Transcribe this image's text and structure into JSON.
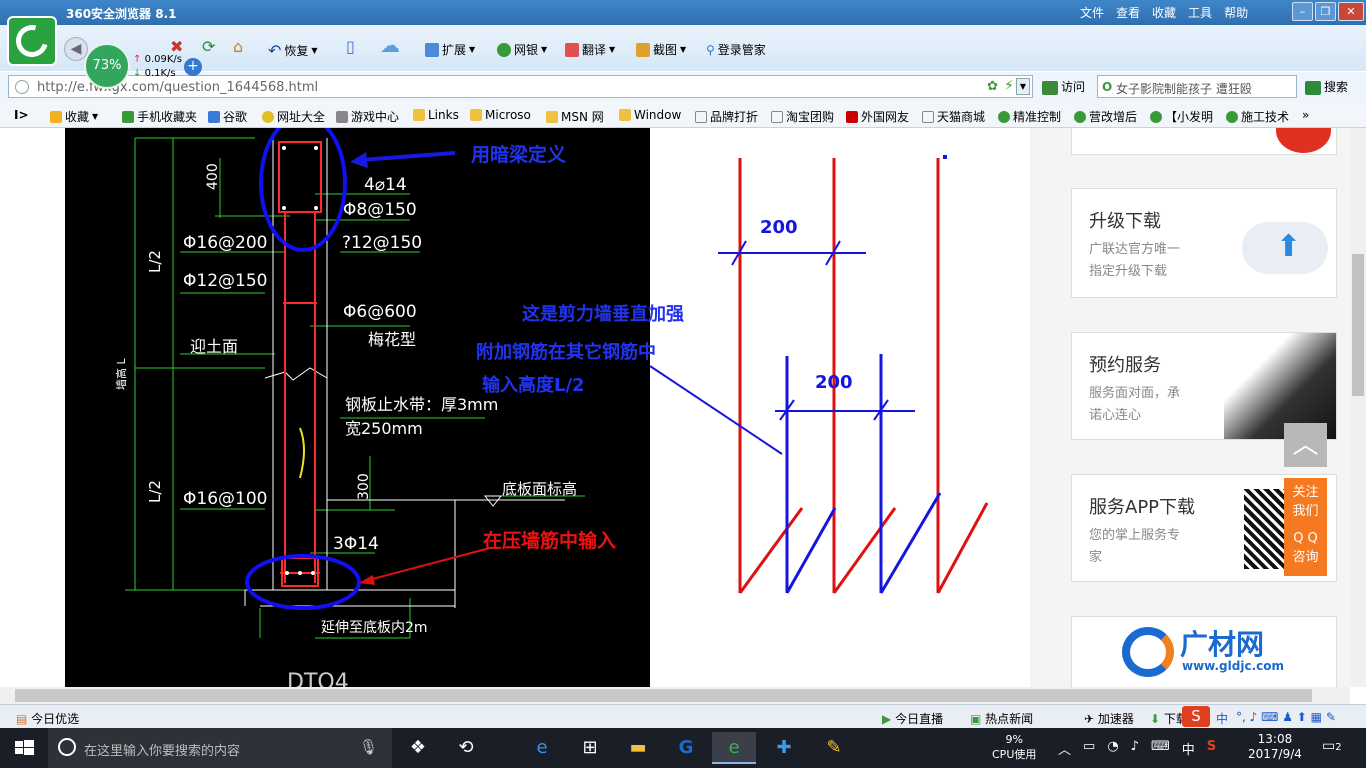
{
  "window": {
    "title": "360安全浏览器 8.1",
    "menu": [
      "文件",
      "查看",
      "收藏",
      "工具",
      "帮助"
    ]
  },
  "speed": {
    "percent": "73%",
    "up": "0.09K/s",
    "down": "0.1K/s"
  },
  "toolbar": {
    "restore": "恢复",
    "extend": "扩展",
    "bank": "网银",
    "translate": "翻译",
    "screenshot": "截图",
    "login": "登录管家"
  },
  "address": {
    "url": "http://e.fwxgx.com/question_1644568.html",
    "visit": "访问",
    "search_value": "女子影院制能孩子 遭狂殴",
    "search_btn": "搜索"
  },
  "favorites": [
    "收藏",
    "手机收藏夹",
    "谷歌",
    "网址大全",
    "游戏中心",
    "Links",
    "Microso",
    "MSN 网",
    "Window",
    "品牌打折",
    "淘宝团购",
    "外国网友",
    "天猫商城",
    "精准控制",
    "营改增后",
    "【小发明",
    "施工技术"
  ],
  "cad": {
    "labels": {
      "dim400": "400",
      "dim300": "300",
      "half1": "L/2",
      "half2": "L/2",
      "wall_height": "墙高 L",
      "r1": "4⌀14",
      "r2": "Φ8@150",
      "r3": "Φ16@200",
      "r4": "?12@150",
      "r5": "Φ12@150",
      "r6": "Φ6@600",
      "r7": "梅花型",
      "soil": "迎土面",
      "waterstop1": "钢板止水带：厚3mm",
      "waterstop2": "宽250mm",
      "r8": "Φ16@100",
      "slab": "底板面标高",
      "r9": "3Φ14",
      "extend": "延伸至底板内2m",
      "dt": "DTQ4"
    },
    "annotations": {
      "dark_beam": "用暗梁定义",
      "press_wall": "在压墙筋中输入"
    }
  },
  "diagram": {
    "dim_top": "200",
    "dim_mid": "200",
    "note1": "这是剪力墙垂直加强",
    "note2": "附加钢筋在其它钢筋中",
    "note3": "输入高度L/2",
    "colors": {
      "red": "#e01010",
      "blue": "#1515e0"
    }
  },
  "sidebar": {
    "cards": [
      {
        "title": "升级下载",
        "desc1": "广联达官方唯一",
        "desc2": "指定升级下载"
      },
      {
        "title": "预约服务",
        "desc1": "服务面对面，承",
        "desc2": "诺心连心"
      },
      {
        "title": "服务APP下载",
        "desc1": "您的掌上服务专",
        "desc2": "家"
      }
    ],
    "follow": [
      "关注",
      "我们",
      "Q Q",
      "咨询"
    ],
    "brand": "广材网",
    "brand_url": "www.gldjc.com",
    "totop": "︿"
  },
  "status": {
    "left": "今日优选",
    "live": "今日直播",
    "news": "热点新闻",
    "accel": "加速器",
    "download": "下载",
    "ime": "中"
  },
  "taskbar": {
    "search_placeholder": "在这里输入你要搜索的内容",
    "cpu_percent": "9%",
    "cpu_label": "CPU使用",
    "ime": "中",
    "time": "13:08",
    "date": "2017/9/4",
    "notif": "2"
  }
}
